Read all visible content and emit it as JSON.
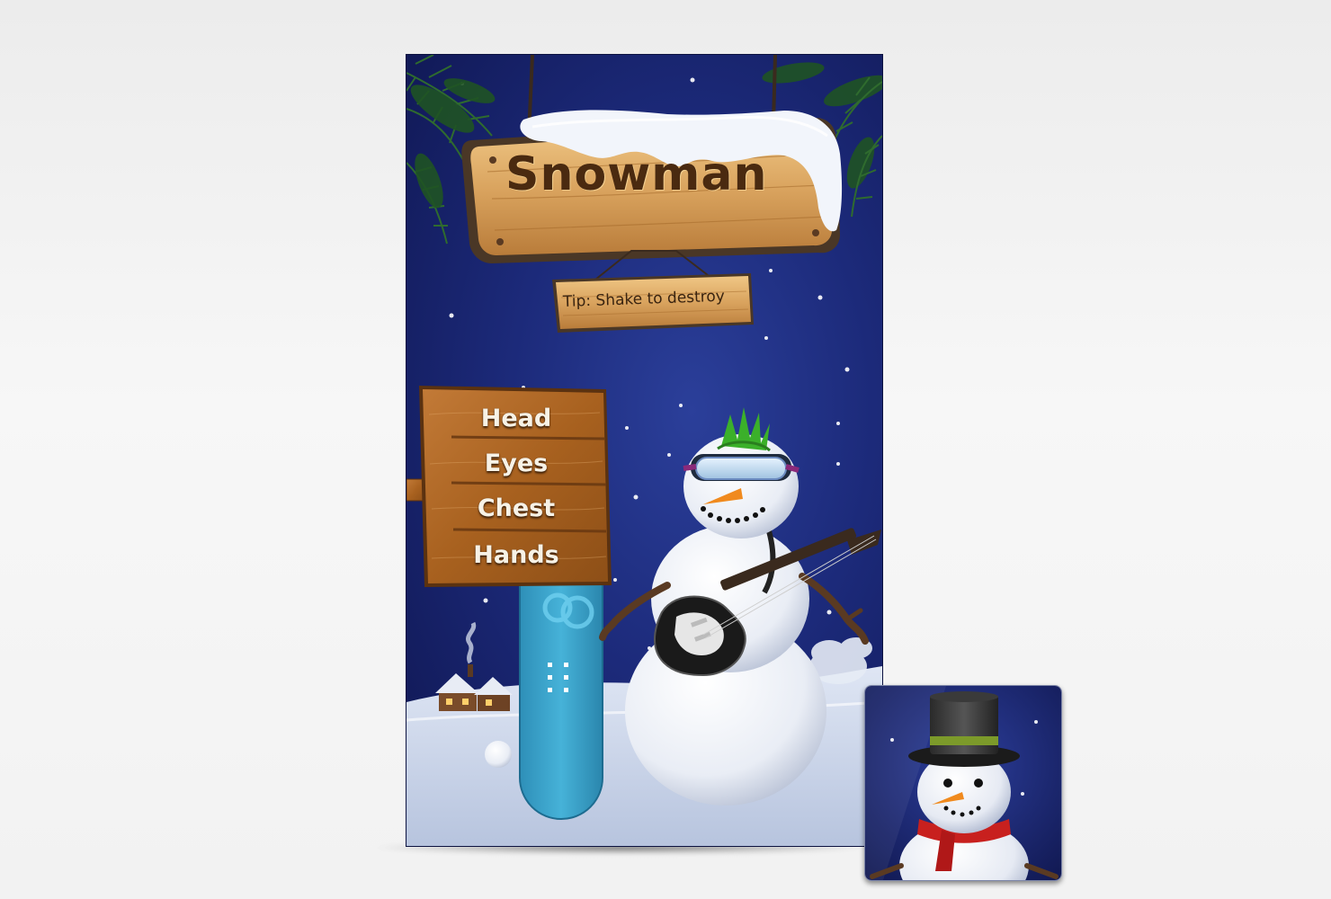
{
  "app": {
    "title": "Snowman",
    "tip": "Tip: Shake to destroy"
  },
  "menu": {
    "items": [
      {
        "label": "Head"
      },
      {
        "label": "Eyes"
      },
      {
        "label": "Chest"
      },
      {
        "label": "Hands"
      }
    ]
  },
  "colors": {
    "sky": "#1c2a7a",
    "wood": "#c98a45",
    "snow": "#f4f6fb",
    "board": "#3fa9d0"
  },
  "icons": {
    "app_icon": "snowman-top-hat-icon"
  }
}
